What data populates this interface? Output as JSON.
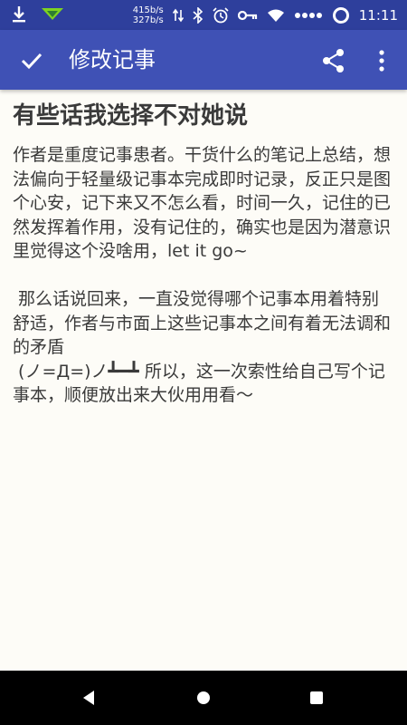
{
  "status_bar": {
    "net_up": "415b/s",
    "net_down": "327b/s",
    "time": "11:11",
    "icons": [
      "download-icon",
      "notification-app-icon",
      "data-arrows-icon",
      "bluetooth-icon",
      "alarm-icon",
      "key-icon",
      "wifi-icon",
      "signal-dots-icon",
      "battery-ring-icon"
    ]
  },
  "app_bar": {
    "title": "修改记事",
    "icons": [
      "check-icon",
      "share-icon",
      "more-vert-icon"
    ]
  },
  "note": {
    "title": "有些话我选择不对她说",
    "body": "作者是重度记事患者。干货什么的笔记上总结，想法偏向于轻量级记事本完成即时记录，反正只是图个心安，记下来又不怎么看，时间一久，记住的已然发挥着作用，没有记住的，确实也是因为潜意识里觉得这个没啥用，let it go~\n\n 那么话说回来，一直没觉得哪个记事本用着特别舒适，作者与市面上这些记事本之间有着无法调和的矛盾\n (ノ=Д=)ノ┻━┻ 所以，这一次索性给自己写个记事本，顺便放出来大伙用用看～"
  },
  "nav_bar": {
    "buttons": [
      "back-icon",
      "home-icon",
      "recents-icon"
    ]
  },
  "colors": {
    "status_bar": "#2e3f9c",
    "app_bar": "#3f51b5",
    "background": "#fdfcf7",
    "text": "#3a3a3a"
  }
}
